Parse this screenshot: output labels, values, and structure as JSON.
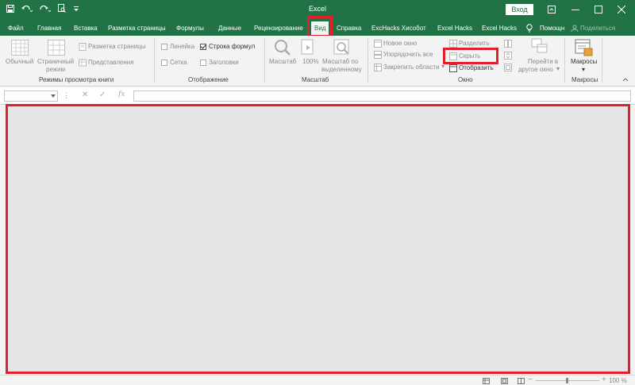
{
  "titlebar": {
    "title": "Excel",
    "login_label": "Вход",
    "bg_color": "#217346"
  },
  "tabs": [
    {
      "label": "Файл"
    },
    {
      "label": "Главная"
    },
    {
      "label": "Вставка"
    },
    {
      "label": "Разметка страницы"
    },
    {
      "label": "Формулы"
    },
    {
      "label": "Данные"
    },
    {
      "label": "Рецензирование"
    },
    {
      "label": "Вид",
      "active": true
    },
    {
      "label": "Справка"
    },
    {
      "label": "ExcHacks Хисобот"
    },
    {
      "label": "Excel Hacks"
    },
    {
      "label": "Excel Hacks"
    },
    {
      "label": "Помощн"
    },
    {
      "label": "Поделиться"
    }
  ],
  "ribbon": {
    "views": {
      "normal": "Обычный",
      "page_mode_1": "Страничный",
      "page_mode_2": "режим",
      "page_layout": "Разметка страницы",
      "custom_views": "Представления",
      "group_label": "Режимы просмотра книги"
    },
    "show": {
      "ruler": "Линейка",
      "formula_bar": "Строка формул",
      "gridlines": "Сетка",
      "headings": "Заголовки",
      "group_label": "Отображение"
    },
    "zoom": {
      "zoom": "Масштаб",
      "hundred": "100%",
      "to_selection_1": "Масштаб по",
      "to_selection_2": "выделенному",
      "group_label": "Масштаб"
    },
    "window": {
      "new_window": "Новое окно",
      "arrange_all": "Упорядочить все",
      "freeze_panes": "Закрепить области",
      "split": "Разделить",
      "hide": "Скрыть",
      "unhide": "Отобразить",
      "switch_1": "Перейти в",
      "switch_2": "другое окно",
      "group_label": "Окно"
    },
    "macros": {
      "label": "Макросы",
      "group_label": "Макросы"
    }
  },
  "formula_bar": {
    "name_value": "",
    "formula_value": "",
    "fx_label": "fx"
  },
  "status": {
    "zoom_text": "100 %"
  },
  "highlight_color": "#e0202a"
}
